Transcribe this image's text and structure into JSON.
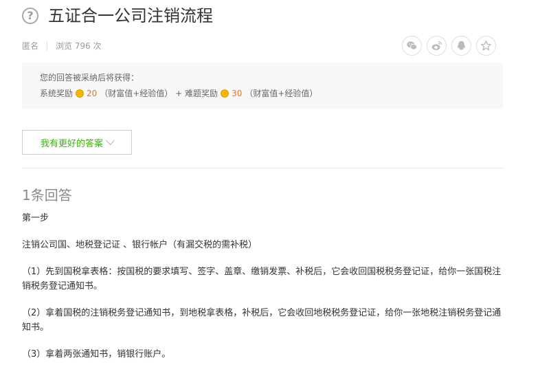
{
  "question": {
    "icon": "question-circle-icon",
    "icon_glyph": "?",
    "title": "五证合一公司注销流程"
  },
  "meta": {
    "author": "匿名",
    "views": "浏览 796 次"
  },
  "share": {
    "icons": [
      "wechat-icon",
      "weibo-icon",
      "qq-icon",
      "favorite-star-icon"
    ]
  },
  "reward": {
    "hint": "您的回答被采纳后将获得：",
    "system_label": "系统奖励",
    "system_points": "20",
    "system_note": "（财富值+经验值）",
    "plus": " + ",
    "difficulty_label": "难题奖励",
    "difficulty_points": "30",
    "difficulty_note": "（财富值+经验值）",
    "accent_color": "#f36c21"
  },
  "better_answer_button": "我有更好的答案",
  "answers_count": "1条回答",
  "answer": {
    "paragraphs": [
      "第一步",
      "注销公司国、地税登记证 、银行帐户（有漏交税的需补税）",
      "（1）先到国税拿表格：按国税的要求填写、签字、盖章、缴销发票、补税后，它会收回国税税务登记证，给你一张国税注销税务登记通知书。",
      "（2）拿着国税的注销税务登记通知书，到地税拿表格，补税后，它会收回地税税务登记证，给你一张地税注销税务登记通知书。",
      "（3）拿着两张通知书，销银行账户。"
    ]
  }
}
